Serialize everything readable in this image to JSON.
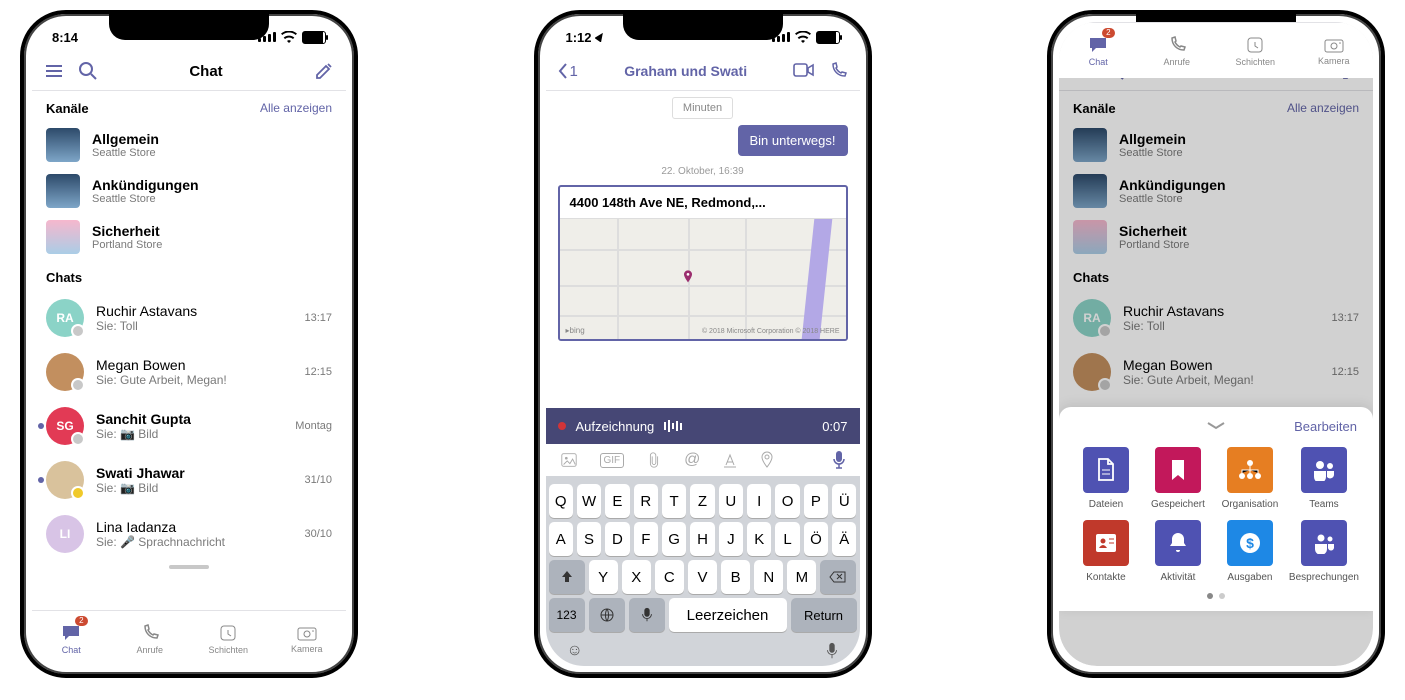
{
  "phone1": {
    "time": "8:14",
    "header": {
      "title": "Chat"
    },
    "section_channels": {
      "label": "Kanäle",
      "link": "Alle anzeigen"
    },
    "channels": [
      {
        "name": "Allgemein",
        "subtitle": "Seattle Store",
        "thumb": "blue"
      },
      {
        "name": "Ankündigungen",
        "subtitle": "Seattle Store",
        "thumb": "blue"
      },
      {
        "name": "Sicherheit",
        "subtitle": "Portland Store",
        "thumb": "pink"
      }
    ],
    "section_chats": {
      "label": "Chats"
    },
    "chats": [
      {
        "name": "Ruchir Astavans",
        "preview": "Sie: Toll",
        "time": "13:17",
        "avatar_bg": "#8bd3c7",
        "initials": "RA",
        "presence": "#c8c8c8",
        "unread": false
      },
      {
        "name": "Megan Bowen",
        "preview": "Sie: Gute Arbeit, Megan!",
        "time": "12:15",
        "avatar_bg": "#c28f5f",
        "initials": "",
        "photo": true,
        "presence": "#c8c8c8",
        "unread": false
      },
      {
        "name": "Sanchit Gupta",
        "preview": "Sie: 📷 Bild",
        "time": "Montag",
        "avatar_bg": "#e23a55",
        "initials": "SG",
        "presence": "#c8c8c8",
        "unread": true,
        "bold": true
      },
      {
        "name": "Swati Jhawar",
        "preview": "Sie: 📷 Bild",
        "time": "31/10",
        "avatar_bg": "#d9c29c",
        "initials": "",
        "photo": true,
        "presence": "#f0c929",
        "unread": true,
        "bold": true
      },
      {
        "name": "Lina Iadanza",
        "preview": "Sie: 🎤 Sprachnachricht",
        "time": "30/10",
        "avatar_bg": "#d8c4e6",
        "initials": "LI",
        "presence": "none",
        "unread": false
      }
    ],
    "navbar": [
      {
        "label": "Chat",
        "icon": "chat",
        "active": true,
        "badge": "2"
      },
      {
        "label": "Anrufe",
        "icon": "call"
      },
      {
        "label": "Schichten",
        "icon": "clock"
      },
      {
        "label": "Kamera",
        "icon": "camera"
      }
    ]
  },
  "phone2": {
    "time": "1:12",
    "back_count": "1",
    "title": "Graham und Swati",
    "truncated_bubble": "Minuten",
    "out_bubble": "Bin unterwegs!",
    "timestamp": "22. Oktober, 16:39",
    "map_address": "4400 148th Ave NE, Redmond,...",
    "map_attrib_left": "▸bing",
    "map_attrib_right": "© 2018 Microsoft Corporation © 2018 HERE",
    "recording": {
      "label": "Aufzeichnung",
      "time": "0:07"
    },
    "keyboard": {
      "rows": [
        [
          "Q",
          "W",
          "E",
          "R",
          "T",
          "Z",
          "U",
          "I",
          "O",
          "P",
          "Ü"
        ],
        [
          "A",
          "S",
          "D",
          "F",
          "G",
          "H",
          "J",
          "K",
          "L",
          "Ö",
          "Ä"
        ]
      ],
      "row3_left_is_shift": true,
      "row3": [
        "Y",
        "X",
        "C",
        "V",
        "B",
        "N",
        "M"
      ],
      "num_label": "123",
      "space_label": "Leerzeichen",
      "return_label": "Return"
    }
  },
  "phone3": {
    "edit_label": "Bearbeiten",
    "apps": [
      {
        "label": "Dateien",
        "color": "#4f52b2",
        "icon": "file"
      },
      {
        "label": "Gespeichert",
        "color": "#c2185b",
        "icon": "bookmark"
      },
      {
        "label": "Organisation",
        "color": "#e67e22",
        "icon": "org"
      },
      {
        "label": "Teams",
        "color": "#4f52b2",
        "icon": "teams"
      },
      {
        "label": "Kontakte",
        "color": "#c0392b",
        "icon": "contact"
      },
      {
        "label": "Aktivität",
        "color": "#4f52b2",
        "icon": "bell"
      },
      {
        "label": "Ausgaben",
        "color": "#1e88e5",
        "icon": "money"
      },
      {
        "label": "Besprechungen",
        "color": "#4f52b2",
        "icon": "meeting"
      }
    ]
  }
}
